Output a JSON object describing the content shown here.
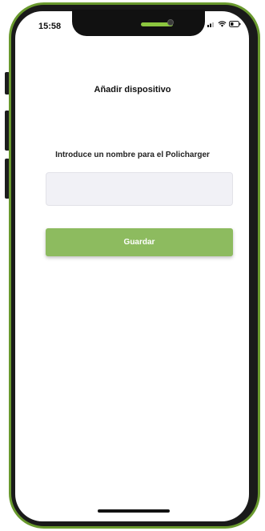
{
  "status_bar": {
    "time": "15:58"
  },
  "screen": {
    "title": "Añadir dispositivo",
    "prompt": "Introduce un nombre para el Policharger",
    "name_input": {
      "value": "",
      "placeholder": ""
    },
    "save_label": "Guardar"
  },
  "colors": {
    "frame_accent": "#6a9a2e",
    "notch_pill": "#8cc63f",
    "button_bg": "#8dbb5f",
    "input_bg": "#f1f1f6"
  },
  "icons": [
    "signal-icon",
    "wifi-icon",
    "battery-icon"
  ]
}
